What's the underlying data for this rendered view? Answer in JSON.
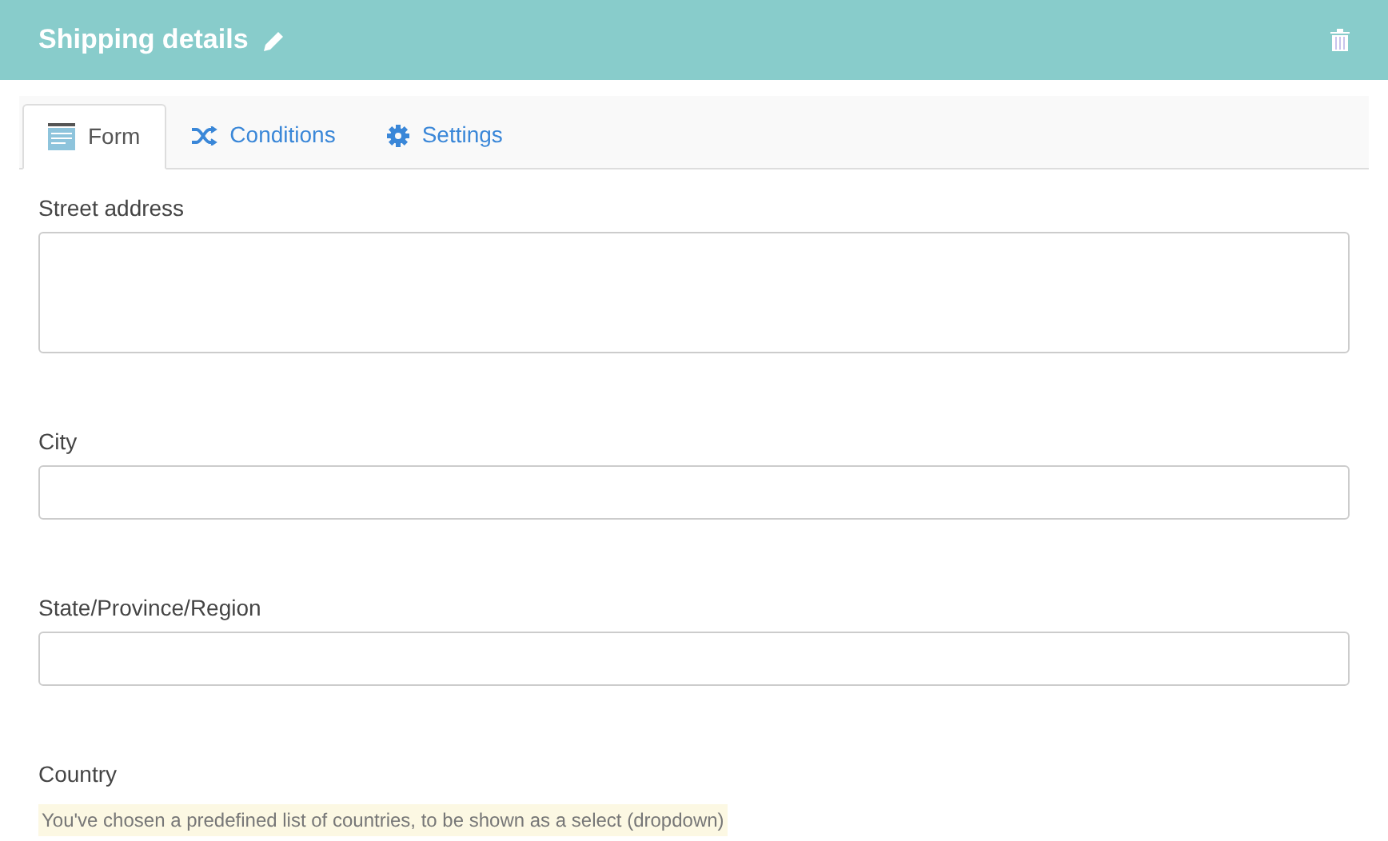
{
  "header": {
    "title": "Shipping details"
  },
  "tabs": [
    {
      "label": "Form",
      "selected": true
    },
    {
      "label": "Conditions",
      "selected": false
    },
    {
      "label": "Settings",
      "selected": false
    }
  ],
  "fields": [
    {
      "label": "Street address",
      "kind": "textarea"
    },
    {
      "label": "City",
      "kind": "input"
    },
    {
      "label": "State/Province/Region",
      "kind": "input"
    },
    {
      "label": "Country",
      "kind": "note",
      "note": "You've chosen a predefined list of countries, to be shown as a select (dropdown)"
    }
  ]
}
